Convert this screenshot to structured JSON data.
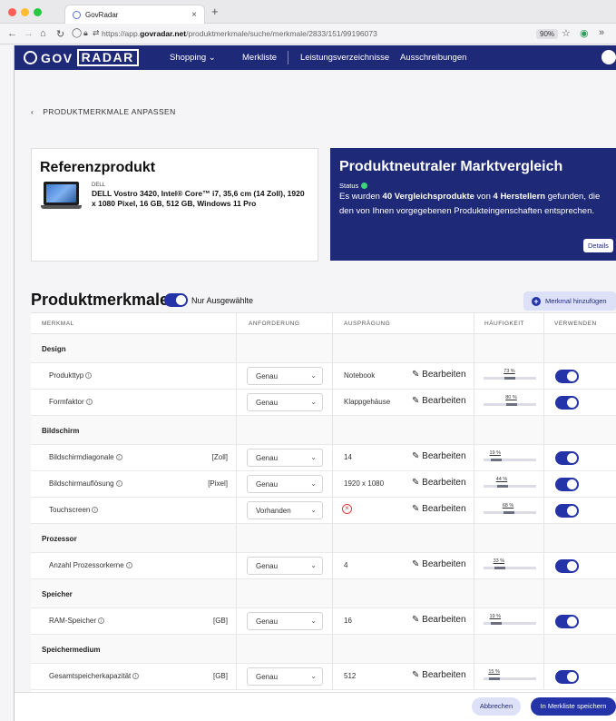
{
  "browser": {
    "tab_title": "GovRadar",
    "url_prefix": "https://app.",
    "url_domain": "govradar.net",
    "url_path": "/produktmerkmale/suche/merkmale/2833/151/99196073",
    "zoom": "90%"
  },
  "appnav": {
    "logo_left": "GOV",
    "logo_right": "RADAR",
    "items": [
      "Shopping",
      "Merkliste",
      "Leistungsverzeichnisse",
      "Ausschreibungen"
    ]
  },
  "back_label": "PRODUKTMERKMALE ANPASSEN",
  "reference": {
    "title": "Referenzprodukt",
    "brand": "DELL",
    "description": "DELL Vostro 3420, Intel® Core™ i7, 35,6 cm (14 Zoll), 1920 x 1080 Pixel, 16 GB, 512 GB, Windows 11 Pro"
  },
  "market": {
    "title": "Produktneutraler Marktvergleich",
    "status_label": "Status",
    "text_1": "Es wurden ",
    "count_products": "40 Vergleichsprodukte",
    "text_2": " von ",
    "count_makers": "4 Herstellern",
    "text_3": " gefunden, die den von Ihnen vorgegebenen Produkteingenschaften entsprechen.",
    "details_label": "Details"
  },
  "merkmale": {
    "title": "Produktmerkmale",
    "filter_label": "Nur Ausgewählte",
    "add_label": "Merkmal hinzufügen",
    "columns": [
      "MERKMAL",
      "ANFORDERUNG",
      "AUSPRÄGUNG",
      "HÄUFIGKEIT",
      "VERWENDEN"
    ],
    "edit_label": "Bearbeiten",
    "groups": [
      {
        "name": "Design",
        "rows": [
          {
            "label": "Produkttyp",
            "unit": "",
            "req": "Genau",
            "value": "Notebook",
            "freq": "73 %",
            "freq_val": 73
          },
          {
            "label": "Formfaktor",
            "unit": "",
            "req": "Genau",
            "value": "Klappgehäuse",
            "freq": "80 %",
            "freq_val": 80
          }
        ]
      },
      {
        "name": "Bildschirm",
        "rows": [
          {
            "label": "Bildschirmdiagonale",
            "unit": "[Zoll]",
            "req": "Genau",
            "value": "14",
            "freq": "19 %",
            "freq_val": 19
          },
          {
            "label": "Bildschirmauflösung",
            "unit": "[Pixel]",
            "req": "Genau",
            "value": "1920 x 1080",
            "freq": "44 %",
            "freq_val": 44
          },
          {
            "label": "Touchscreen",
            "unit": "",
            "req": "Vorhanden",
            "value": "",
            "freq": "68 %",
            "freq_val": 68
          }
        ]
      },
      {
        "name": "Prozessor",
        "rows": [
          {
            "label": "Anzahl Prozessorkerne",
            "unit": "",
            "req": "Genau",
            "value": "4",
            "freq": "33 %",
            "freq_val": 33
          }
        ]
      },
      {
        "name": "Speicher",
        "rows": [
          {
            "label": "RAM-Speicher",
            "unit": "[GB]",
            "req": "Genau",
            "value": "16",
            "freq": "19 %",
            "freq_val": 19
          }
        ]
      },
      {
        "name": "Speichermedium",
        "rows": [
          {
            "label": "Gesamtspeicherkapazität",
            "unit": "[GB]",
            "req": "Genau",
            "value": "512",
            "freq": "15 %",
            "freq_val": 15
          }
        ]
      }
    ]
  },
  "footer": {
    "cancel_label": "Abbrechen",
    "save_label": "In Merkliste speichern"
  },
  "colors": {
    "brand": "#1e2978",
    "accent": "#2433a8",
    "status_ok": "#3ed47a",
    "negative": "#e03c3c"
  }
}
